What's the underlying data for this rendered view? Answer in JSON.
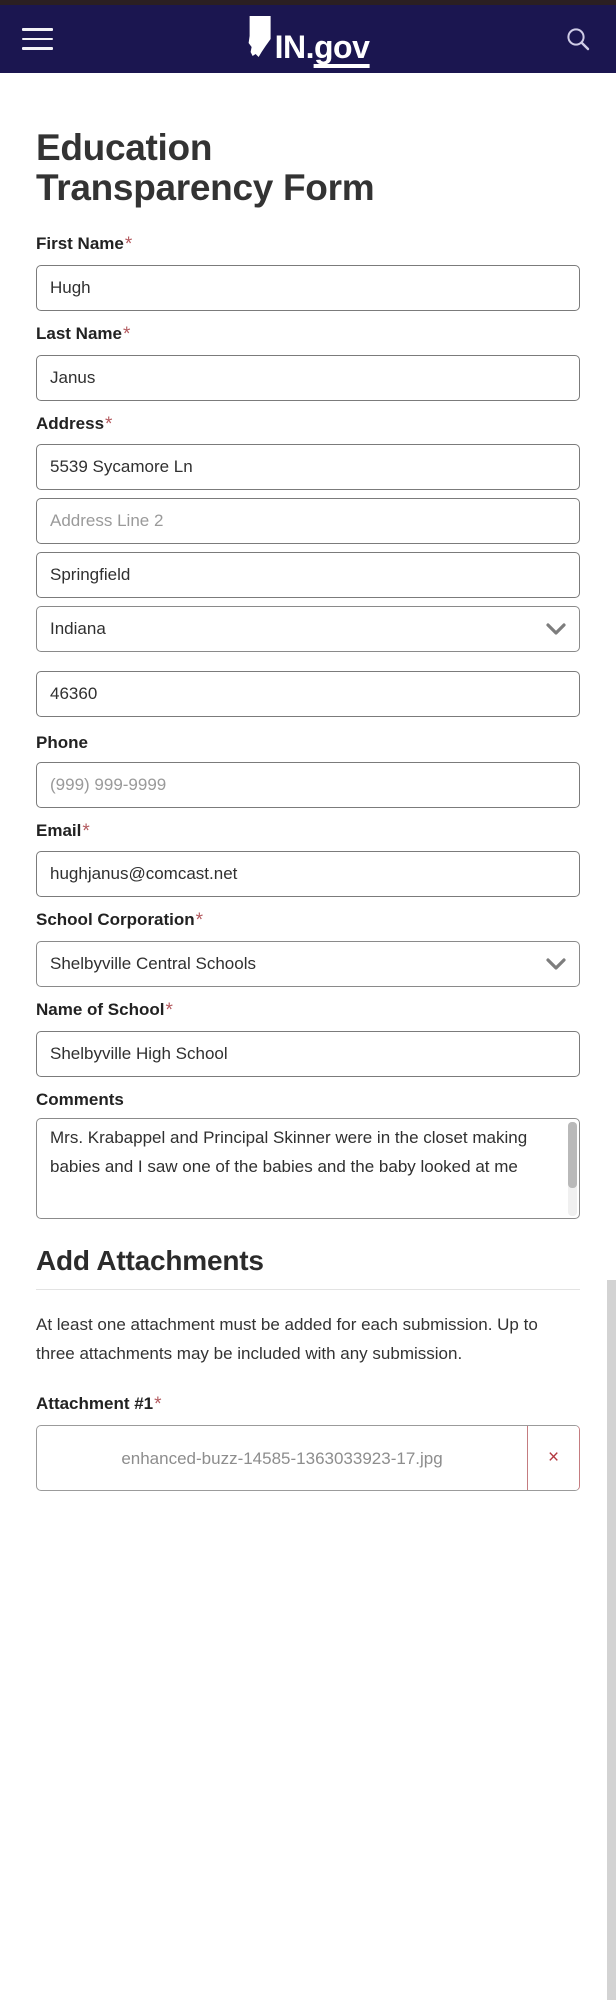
{
  "header": {
    "menu_icon": "hamburger-menu-icon",
    "brand_in": "IN",
    "brand_dot": ".",
    "brand_gov": "gov",
    "search_icon": "search-icon",
    "background_color": "#1b1650"
  },
  "form": {
    "title": "Education Transparency Form",
    "required_marker": "*",
    "fields": {
      "first_name": {
        "label": "First Name",
        "required": true,
        "value": "Hugh"
      },
      "last_name": {
        "label": "Last Name",
        "required": true,
        "value": "Janus"
      },
      "address": {
        "label": "Address",
        "required": true,
        "line1_value": "5539 Sycamore Ln",
        "line2_placeholder": "Address Line 2",
        "line2_value": "",
        "city_value": "Springfield",
        "state_value": "Indiana",
        "zip_value": "46360"
      },
      "phone": {
        "label": "Phone",
        "required": false,
        "placeholder": "(999) 999-9999",
        "value": ""
      },
      "email": {
        "label": "Email",
        "required": true,
        "value": "hughjanus@comcast.net"
      },
      "school_corporation": {
        "label": "School Corporation",
        "required": true,
        "value": "Shelbyville Central Schools"
      },
      "name_of_school": {
        "label": "Name of School",
        "required": true,
        "value": "Shelbyville High School"
      },
      "comments": {
        "label": "Comments",
        "required": false,
        "value": "Mrs. Krabappel and Principal Skinner were in the closet making babies and I saw one of the babies and the baby looked at me"
      }
    }
  },
  "attachments": {
    "section_title": "Add Attachments",
    "description": "At least one attachment must be added for each submission.  Up to three attachments may be included with any submission.",
    "items": [
      {
        "label": "Attachment #1",
        "required": true,
        "filename": "enhanced-buzz-14585-1363033923-17.jpg",
        "remove_label": "×"
      }
    ]
  },
  "colors": {
    "header_navy": "#1b1650",
    "required_asterisk": "#b35a5f",
    "remove_red": "#b3383f",
    "text_dark": "#333333",
    "placeholder_gray": "#9a9a9a"
  }
}
